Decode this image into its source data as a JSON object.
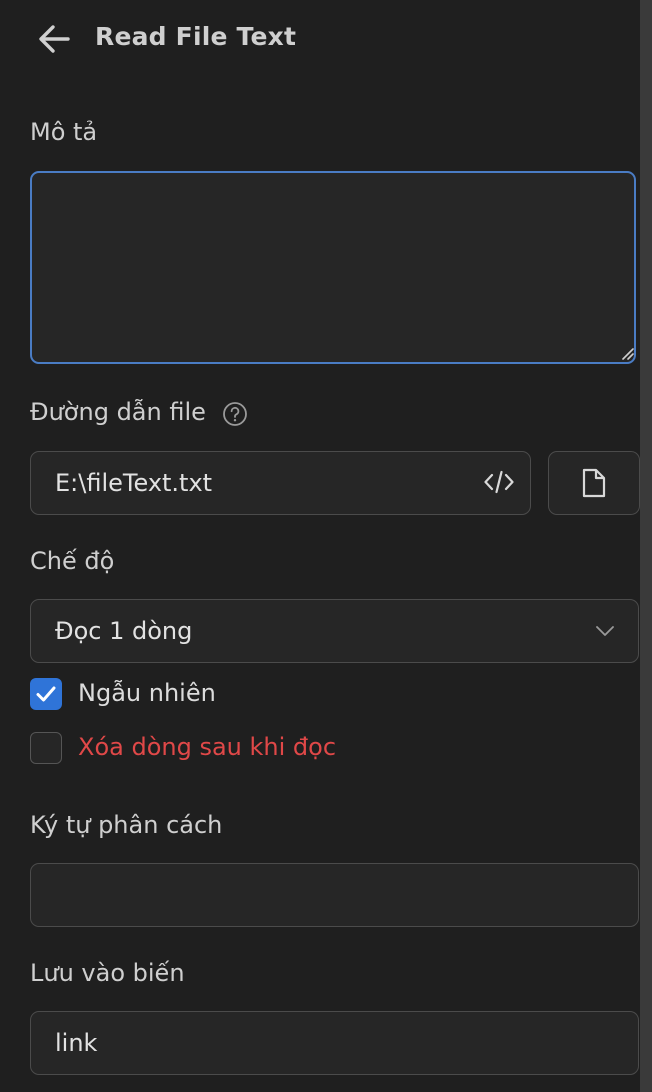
{
  "header": {
    "title": "Read File Text"
  },
  "description": {
    "label": "Mô tả",
    "value": ""
  },
  "file_path": {
    "label": "Đường dẫn file",
    "value": "E:\\fileText.txt"
  },
  "mode": {
    "label": "Chế độ",
    "selected": "Đọc 1 dòng"
  },
  "options": {
    "random": {
      "label": "Ngẫu nhiên",
      "checked": true
    },
    "delete_after_read": {
      "label": "Xóa dòng sau khi đọc",
      "checked": false
    }
  },
  "separator": {
    "label": "Ký tự phân cách",
    "value": ""
  },
  "save_to_variable": {
    "label": "Lưu vào biến",
    "value": "link"
  },
  "colors": {
    "background": "#1f1f1f",
    "field_bg": "#262626",
    "accent": "#2f74d8",
    "focus_border": "#4a7cc4",
    "danger_text": "#e04848"
  },
  "icons": {
    "back": "arrow-left-icon",
    "help": "question-circle-icon",
    "code": "code-icon",
    "file": "file-icon",
    "chevron": "chevron-down-icon",
    "check": "check-icon"
  }
}
